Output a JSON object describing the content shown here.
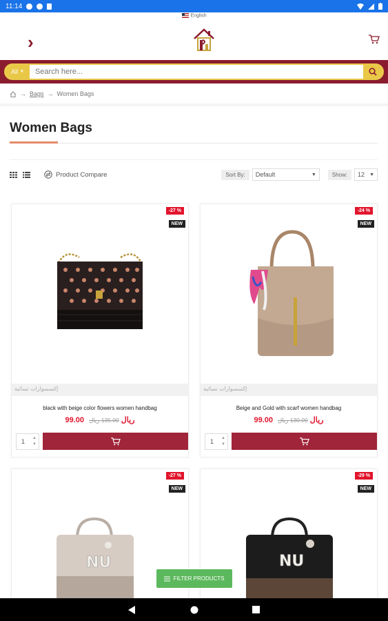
{
  "status": {
    "time": "11:14"
  },
  "language": "English",
  "search": {
    "category": "All",
    "placeholder": "Search here..."
  },
  "breadcrumb": {
    "items": [
      "Bags",
      "Women Bags"
    ]
  },
  "page_title": "Women Bags",
  "toolbar": {
    "compare_label": "Product Compare",
    "sort_label": "Sort By:",
    "sort_value": "Default",
    "show_label": "Show:",
    "show_value": "12"
  },
  "products": [
    {
      "sale": "-27 %",
      "new": "NEW",
      "brand": "إكسسوارات نسائية",
      "name": "black with beige color flowers women handbag",
      "price": "99.00 ريال",
      "old_price": "135.00 ريال",
      "qty": "1"
    },
    {
      "sale": "-24 %",
      "new": "NEW",
      "brand": "إكسسوارات نسائية",
      "name": "Beige and Gold with scarf women handbag",
      "price": "99.00 ريال",
      "old_price": "130.00 ريال",
      "qty": "1"
    },
    {
      "sale": "-27 %",
      "new": "NEW"
    },
    {
      "sale": "-29 %",
      "new": "NEW"
    }
  ],
  "filter_button": "FILTER PRODUCTS",
  "colors": {
    "brand": "#8b1b2e",
    "accent": "#e9c847",
    "sale": "#e2142c",
    "filter": "#5cb85c"
  }
}
